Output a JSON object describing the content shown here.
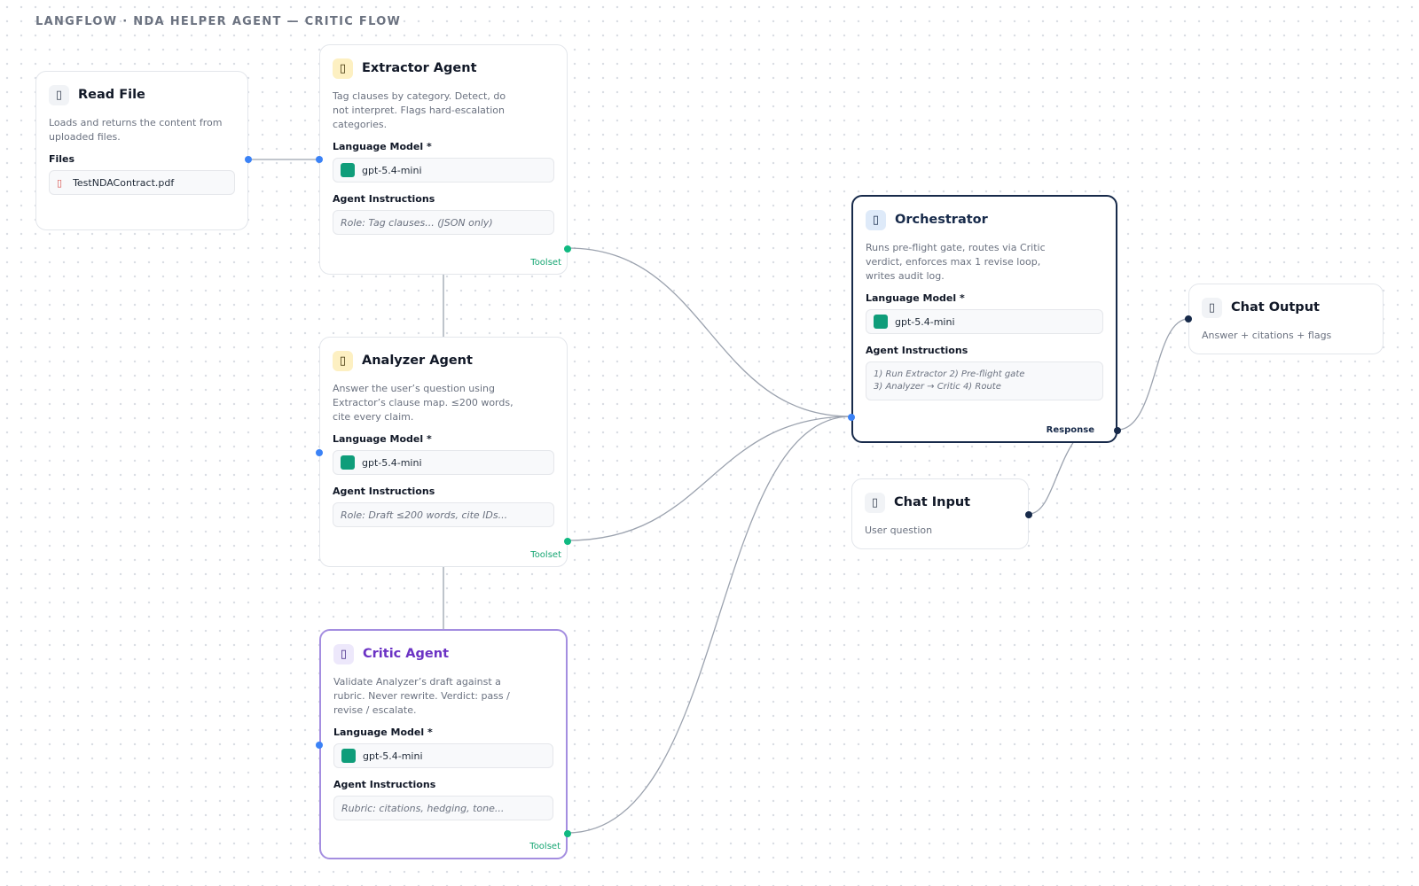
{
  "canvas_title": "LANGFLOW · NDA HELPER AGENT — CRITIC FLOW",
  "nodes": {
    "read_file": {
      "icon": "file-icon",
      "title": "Read File",
      "description": "Loads and returns the content from uploaded files.",
      "files_label": "Files",
      "file_name": "TestNDAContract.pdf"
    },
    "extractor": {
      "icon": "robot-icon",
      "title": "Extractor Agent",
      "description": "Tag clauses by category. Detect, do not interpret. Flags hard-escalation categories.",
      "model_label": "Language Model *",
      "model_value": "gpt-5.4-mini",
      "instructions_label": "Agent Instructions",
      "instructions_value": "Role: Tag clauses... (JSON only)",
      "output_label": "Toolset"
    },
    "analyzer": {
      "icon": "robot-icon",
      "title": "Analyzer Agent",
      "description": "Answer the user’s question using Extractor’s clause map. ≤200 words, cite every claim.",
      "model_label": "Language Model *",
      "model_value": "gpt-5.4-mini",
      "instructions_label": "Agent Instructions",
      "instructions_value": "Role: Draft ≤200 words, cite IDs...",
      "output_label": "Toolset"
    },
    "critic": {
      "icon": "robot-icon",
      "title": "Critic Agent",
      "description": "Validate Analyzer’s draft against a rubric. Never rewrite. Verdict: pass / revise / escalate.",
      "model_label": "Language Model *",
      "model_value": "gpt-5.4-mini",
      "instructions_label": "Agent Instructions",
      "instructions_value": "Rubric: citations, hedging, tone...",
      "output_label": "Toolset"
    },
    "orchestrator": {
      "icon": "robot-icon",
      "title": "Orchestrator",
      "description": "Runs pre-flight gate, routes via Critic verdict, enforces max 1 revise loop, writes audit log.",
      "model_label": "Language Model *",
      "model_value": "gpt-5.4-mini",
      "instructions_label": "Agent Instructions",
      "instructions_line1": "1) Run Extractor 2) Pre-flight gate",
      "instructions_line2": "3) Analyzer → Critic 4) Route",
      "output_label": "Response"
    },
    "chat_input": {
      "icon": "chat-icon",
      "title": "Chat Input",
      "description": "User question"
    },
    "chat_output": {
      "icon": "chat-icon",
      "title": "Chat Output",
      "description": "Answer + citations + flags"
    }
  },
  "colors": {
    "edge": "#9ca3af",
    "port_input": "#3b82f6",
    "port_toolset": "#10b981",
    "critic_border": "#a48ee0",
    "orchestrator_border": "#172a4a",
    "model_chip": "#0f9d7a"
  }
}
